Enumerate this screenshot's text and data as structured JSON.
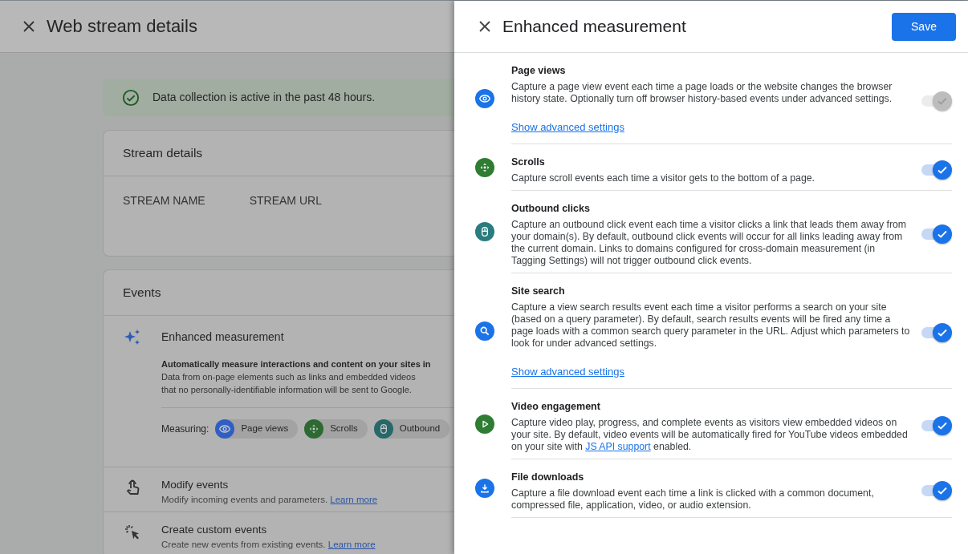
{
  "page": {
    "title": "Web stream details",
    "banner": "Data collection is active in the past 48 hours.",
    "stream_card": {
      "title": "Stream details",
      "columns": [
        "STREAM NAME",
        "STREAM URL"
      ]
    },
    "events_card": {
      "title": "Events",
      "enhanced": {
        "title": "Enhanced measurement",
        "lines": [
          "Automatically measure interactions and content on your sites in",
          "Data from on-page elements such as links and embedded videos",
          "that no personally-identifiable information will be sent to Google."
        ],
        "measuring_label": "Measuring:",
        "chips": [
          {
            "kind": "eye",
            "label": "Page views",
            "color": "#2f5fc4"
          },
          {
            "kind": "scroll",
            "label": "Scrolls",
            "color": "#2c6a32"
          },
          {
            "kind": "mouse",
            "label": "Outbound",
            "color": "#27686a"
          }
        ]
      },
      "items": [
        {
          "kind": "touch",
          "title": "Modify events",
          "text": "Modify incoming events and parameters.",
          "link": "Learn more"
        },
        {
          "kind": "click",
          "title": "Create custom events",
          "text": "Create new events from existing events.",
          "link": "Learn more"
        }
      ]
    }
  },
  "panel": {
    "title": "Enhanced measurement",
    "save": "Save",
    "rows": [
      {
        "kind": "eye",
        "color": "#1a73e8",
        "title": "Page views",
        "text": "Capture a page view event each time a page loads or the website changes the browser history state. Optionally turn off browser history-based events under advanced settings.",
        "advanced": "Show advanced settings",
        "on": true,
        "disabled": true
      },
      {
        "kind": "scroll",
        "color": "#2e7d32",
        "title": "Scrolls",
        "text": "Capture scroll events each time a visitor gets to the bottom of a page.",
        "on": true,
        "disabled": false
      },
      {
        "kind": "mouse",
        "color": "#2a7c7e",
        "title": "Outbound clicks",
        "text": "Capture an outbound click event each time a visitor clicks a link that leads them away from your domain(s). By default, outbound click events will occur for all links leading away from the current domain. Links to domains configured for cross-domain measurement (in Tagging Settings) will not trigger outbound click events.",
        "on": true,
        "disabled": false
      },
      {
        "kind": "search",
        "color": "#1a73e8",
        "title": "Site search",
        "text": "Capture a view search results event each time a visitor performs a search on your site (based on a query parameter). By default, search results events will be fired any time a page loads with a common search query parameter in the URL. Adjust which parameters to look for under advanced settings.",
        "advanced": "Show advanced settings",
        "on": true,
        "disabled": false
      },
      {
        "kind": "play",
        "color": "#2e7d32",
        "title": "Video engagement",
        "text": "Capture video play, progress, and complete events as visitors view embedded videos on your site. By default, video events will be automatically fired for YouTube videos embedded on your site with",
        "link": "JS API support",
        "text_after": "enabled.",
        "on": true,
        "disabled": false
      },
      {
        "kind": "download",
        "color": "#1a73e8",
        "title": "File downloads",
        "text": "Capture a file download event each time a link is clicked with a common document, compressed file, application, video, or audio extension.",
        "on": true,
        "disabled": false
      }
    ]
  }
}
